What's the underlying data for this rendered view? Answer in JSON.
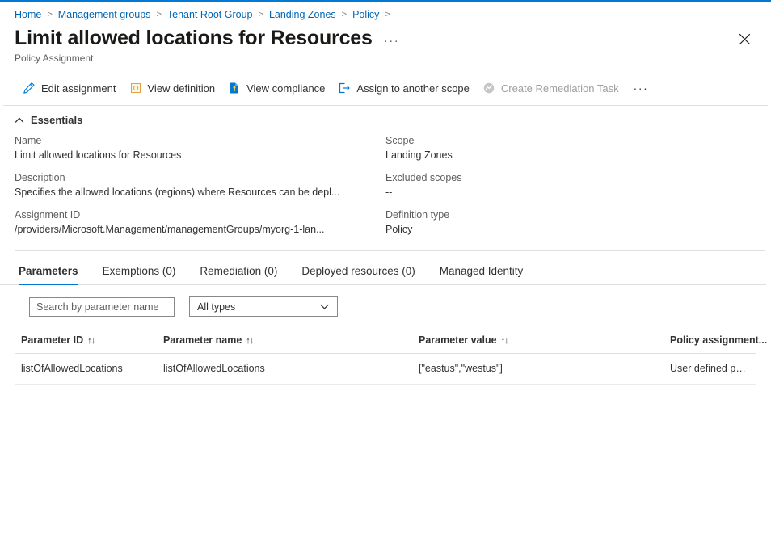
{
  "theme": {
    "accent": "#0078d4",
    "link": "#0066b4",
    "muted": "#605e5c",
    "disabled": "#a19f9d",
    "divider": "#e1dfdd"
  },
  "breadcrumb": {
    "items": [
      {
        "label": "Home"
      },
      {
        "label": "Management groups"
      },
      {
        "label": "Tenant Root Group"
      },
      {
        "label": "Landing Zones"
      },
      {
        "label": "Policy"
      }
    ],
    "separator": ">"
  },
  "header": {
    "title": "Limit allowed locations for Resources",
    "ellipsis": "···",
    "subtitle": "Policy Assignment",
    "close_label": "Close"
  },
  "command_bar": {
    "items": [
      {
        "label": "Edit assignment",
        "icon": "pencil-icon",
        "disabled": false
      },
      {
        "label": "View definition",
        "icon": "policy-definition-icon",
        "disabled": false
      },
      {
        "label": "View compliance",
        "icon": "compliance-document-icon",
        "disabled": false
      },
      {
        "label": "Assign to another scope",
        "icon": "assign-scope-icon",
        "disabled": false
      },
      {
        "label": "Create Remediation Task",
        "icon": "remediation-chart-icon",
        "disabled": true
      }
    ],
    "more_label": "···"
  },
  "essentials": {
    "section_label": "Essentials",
    "left": [
      {
        "key": "Name",
        "value": "Limit allowed locations for Resources"
      },
      {
        "key": "Description",
        "value": "Specifies the allowed locations (regions) where Resources can be depl..."
      },
      {
        "key": "Assignment ID",
        "value": "/providers/Microsoft.Management/managementGroups/myorg-1-lan..."
      }
    ],
    "right": [
      {
        "key": "Scope",
        "value": "Landing Zones"
      },
      {
        "key": "Excluded scopes",
        "value": "--"
      },
      {
        "key": "Definition type",
        "value": "Policy"
      }
    ]
  },
  "tabs": [
    {
      "label": "Parameters",
      "active": true
    },
    {
      "label": "Exemptions (0)",
      "active": false
    },
    {
      "label": "Remediation (0)",
      "active": false
    },
    {
      "label": "Deployed resources (0)",
      "active": false
    },
    {
      "label": "Managed Identity",
      "active": false
    }
  ],
  "filters": {
    "search": {
      "placeholder": "Search by parameter name",
      "value": ""
    },
    "type_filter": {
      "selected": "All types"
    }
  },
  "table": {
    "columns": [
      {
        "label": "Parameter ID",
        "sortable": true
      },
      {
        "label": "Parameter name",
        "sortable": true
      },
      {
        "label": "Parameter value",
        "sortable": true
      },
      {
        "label": "Policy assignment...",
        "sortable": true
      }
    ],
    "sort_glyph": "↑↓",
    "rows": [
      {
        "parameter_id": "listOfAllowedLocations",
        "parameter_name": "listOfAllowedLocations",
        "parameter_value": "[\"eastus\",\"westus\"]",
        "policy_assignment": "User defined parameter"
      }
    ]
  }
}
